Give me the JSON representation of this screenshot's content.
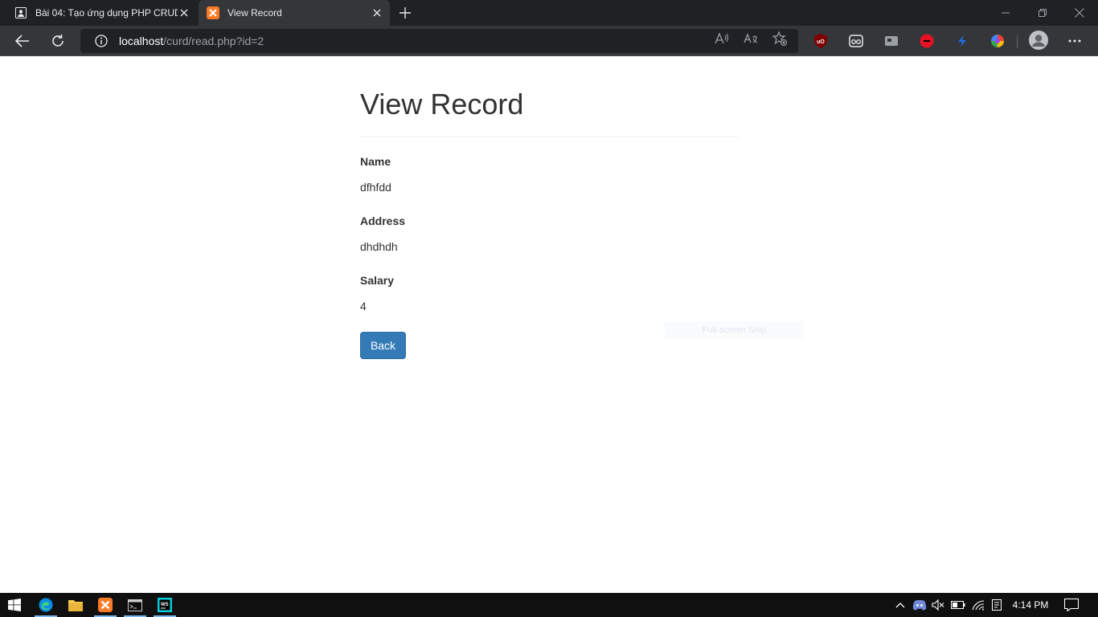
{
  "browser": {
    "tabs": [
      {
        "title": "Bài 04: Tạo ứng dụng PHP CRUD",
        "active": false
      },
      {
        "title": "View Record",
        "active": true
      }
    ],
    "url": {
      "host": "localhost",
      "path": "/curd/read.php?id=2"
    }
  },
  "page": {
    "heading": "View Record",
    "fields": [
      {
        "label": "Name",
        "value": "dfhfdd"
      },
      {
        "label": "Address",
        "value": "dhdhdh"
      },
      {
        "label": "Salary",
        "value": "4"
      }
    ],
    "back_label": "Back",
    "snip_hint": "Full-screen Snip"
  },
  "taskbar": {
    "time": "4:14 PM"
  },
  "colors": {
    "accent": "#337ab7",
    "tabstrip": "#202124",
    "toolbar": "#35363a",
    "taskbar": "#101010"
  }
}
